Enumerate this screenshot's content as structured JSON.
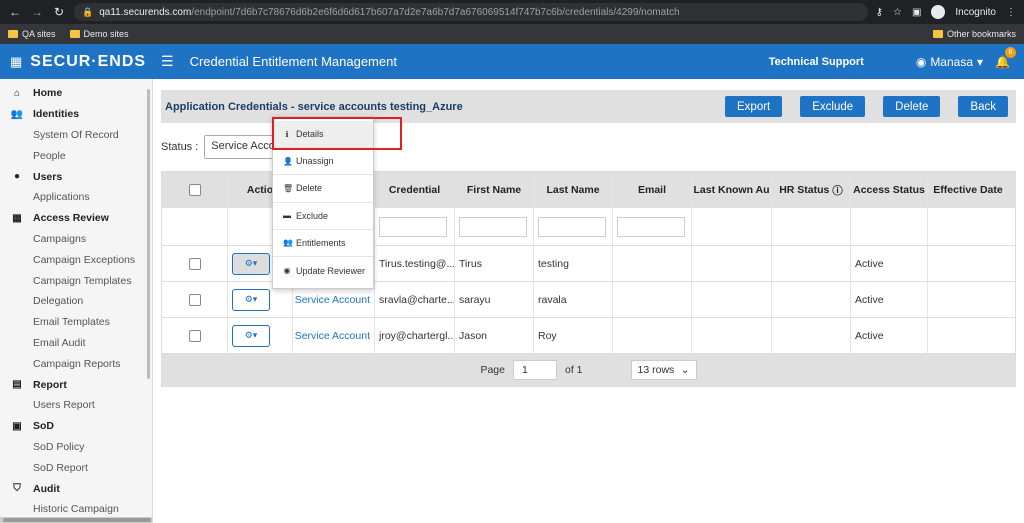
{
  "browser": {
    "url_host": "qa11.securends.com",
    "url_path": "/endpoint/7d6b7c78676d6b2e6f6d6d617b607a7d2e7a6b7d7a676069514f747b7c6b/credentials/4299/nomatch",
    "incognito_label": "Incognito",
    "bookmarks": [
      "QA sites",
      "Demo sites"
    ],
    "other_bookmarks": "Other bookmarks"
  },
  "header": {
    "logo": "SECUR·ENDS",
    "title": "Credential Entitlement Management",
    "support": "Technical Support",
    "user": "Manasa",
    "notification_count": "6"
  },
  "sidebar": {
    "items": [
      {
        "label": "Home",
        "type": "section",
        "icon": "home-icon"
      },
      {
        "label": "Identities",
        "type": "section",
        "icon": "users-icon"
      },
      {
        "label": "System Of Record",
        "type": "sub"
      },
      {
        "label": "People",
        "type": "sub"
      },
      {
        "label": "Users",
        "type": "section",
        "icon": "user-icon"
      },
      {
        "label": "Applications",
        "type": "sub"
      },
      {
        "label": "Access Review",
        "type": "section",
        "icon": "grid-icon"
      },
      {
        "label": "Campaigns",
        "type": "sub"
      },
      {
        "label": "Campaign Exceptions",
        "type": "sub"
      },
      {
        "label": "Campaign Templates",
        "type": "sub"
      },
      {
        "label": "Delegation",
        "type": "sub"
      },
      {
        "label": "Email Templates",
        "type": "sub"
      },
      {
        "label": "Email Audit",
        "type": "sub"
      },
      {
        "label": "Campaign Reports",
        "type": "sub"
      },
      {
        "label": "Report",
        "type": "section",
        "icon": "report-icon"
      },
      {
        "label": "Users Report",
        "type": "sub"
      },
      {
        "label": "SoD",
        "type": "section",
        "icon": "sod-icon"
      },
      {
        "label": "SoD Policy",
        "type": "sub"
      },
      {
        "label": "SoD Report",
        "type": "sub"
      },
      {
        "label": "Audit",
        "type": "section",
        "icon": "shield-icon"
      },
      {
        "label": "Historic Campaign",
        "type": "sub"
      }
    ]
  },
  "page": {
    "title": "Application Credentials - service accounts testing_Azure",
    "buttons": {
      "export": "Export",
      "exclude": "Exclude",
      "delete": "Delete",
      "back": "Back"
    },
    "status_label": "Status :",
    "status_value": "Service Accoun"
  },
  "table": {
    "columns": [
      "",
      "Actio",
      "",
      "Credential",
      "First Name",
      "Last Name",
      "Email",
      "Last Known Au",
      "HR Status",
      "Access Status",
      "Effective Date"
    ],
    "rows": [
      {
        "type": "Service Account",
        "credential": "Tirus.testing@...",
        "first": "Tirus",
        "last": "testing",
        "email": "",
        "access": "Active"
      },
      {
        "type": "Service Account",
        "credential": "sravla@charte...",
        "first": "sarayu",
        "last": "ravala",
        "email": "",
        "access": "Active"
      },
      {
        "type": "Service Account",
        "credential": "jroy@chartergl...",
        "first": "Jason",
        "last": "Roy",
        "email": "",
        "access": "Active"
      }
    ]
  },
  "pager": {
    "page_label": "Page",
    "page_value": "1",
    "of_label": "of 1",
    "rows_value": "13 rows"
  },
  "dropdown": {
    "items": [
      {
        "label": "Details",
        "icon": "info-icon"
      },
      {
        "label": "Unassign",
        "icon": "unassign-icon"
      },
      {
        "label": "Delete",
        "icon": "trash-icon"
      },
      {
        "label": "Exclude",
        "icon": "minus-icon"
      },
      {
        "label": "Entitlements",
        "icon": "group-icon"
      },
      {
        "label": "Update Reviewer",
        "icon": "reviewer-icon"
      }
    ]
  }
}
